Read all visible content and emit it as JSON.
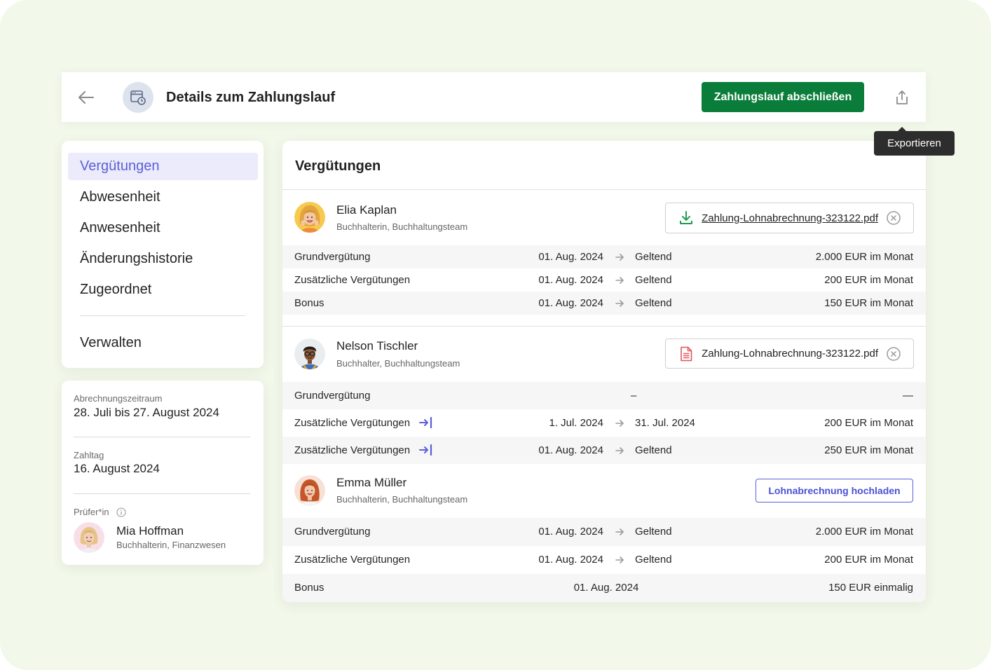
{
  "header": {
    "back_icon": "arrow-left-icon",
    "page_icon": "calendar-clock-icon",
    "title": "Details zum Zahlungslauf",
    "primary_action": "Zahlungslauf abschließen",
    "export_icon": "share-upload-icon",
    "export_tooltip": "Exportieren"
  },
  "sidebar": {
    "items": [
      {
        "label": "Vergütungen",
        "selected": true
      },
      {
        "label": "Abwesenheit",
        "selected": false
      },
      {
        "label": "Anwesenheit",
        "selected": false
      },
      {
        "label": "Änderungshistorie",
        "selected": false
      },
      {
        "label": "Zugeordnet",
        "selected": false
      }
    ],
    "manage": {
      "label": "Verwalten"
    }
  },
  "summary": {
    "period_label": "Abrechnungszeitraum",
    "period_value": "28. Juli bis 27. August 2024",
    "payday_label": "Zahltag",
    "payday_value": "16. August 2024",
    "reviewer_label": "Prüfer*in",
    "reviewer_info_icon": "info-icon",
    "reviewer_name": "Mia Hoffman",
    "reviewer_role": "Buchhalterin, Finanzwesen"
  },
  "main": {
    "title": "Vergütungen",
    "employees": [
      {
        "name": "Elia Kaplan",
        "role": "Buchhalterin, Buchhaltungsteam",
        "attachment": {
          "file_name": "Zahlung-Lohnabrechnung-323122.pdf",
          "icon": "download-icon",
          "remove_icon": "close-circle-icon"
        },
        "rows": [
          {
            "label": "Grundvergütung",
            "from": "01. Aug. 2024",
            "to": "Geltend",
            "amount": "2.000 EUR im Monat"
          },
          {
            "label": "Zusätzliche Vergütungen",
            "from": "01. Aug. 2024",
            "to": "Geltend",
            "amount": "200 EUR im Monat"
          },
          {
            "label": "Bonus",
            "from": "01. Aug. 2024",
            "to": "Geltend",
            "amount": "150 EUR im Monat"
          }
        ]
      },
      {
        "name": "Nelson Tischler",
        "role": "Buchhalter, Buchhaltungsteam",
        "attachment": {
          "file_name": "Zahlung-Lohnabrechnung-323122.pdf",
          "icon": "pdf-file-icon",
          "remove_icon": "close-circle-icon"
        },
        "rows": [
          {
            "label": "Grundvergütung",
            "to": "–",
            "amount": "—"
          },
          {
            "label": "Zusätzliche Vergütungen",
            "icon": "arrow-right-to-line-icon",
            "from": "1. Jul. 2024",
            "to": "31. Jul. 2024",
            "amount": "200 EUR im Monat"
          },
          {
            "label": "Zusätzliche Vergütungen",
            "icon": "arrow-right-to-line-icon",
            "from": "01. Aug. 2024",
            "to": "Geltend",
            "amount": "250 EUR im Monat"
          }
        ]
      },
      {
        "name": "Emma Müller",
        "role": "Buchhalterin, Buchhaltungsteam",
        "upload_button": "Lohnabrechnung hochladen",
        "rows": [
          {
            "label": "Grundvergütung",
            "from": "01. Aug. 2024",
            "to": "Geltend",
            "amount": "2.000 EUR im Monat"
          },
          {
            "label": "Zusätzliche Vergütungen",
            "from": "01. Aug. 2024",
            "to": "Geltend",
            "amount": "200 EUR im Monat"
          },
          {
            "label": "Bonus",
            "date": "01. Aug. 2024",
            "amount": "150 EUR einmalig"
          }
        ]
      }
    ]
  },
  "colors": {
    "page_background": "#f2f8ea",
    "primary": "#0b7d3a",
    "accent": "#5a5fd8",
    "selected_background": "#ebebfb",
    "download": "#1f9d4e",
    "pdf": "#e0565b",
    "tooltip": "#2d2d2d"
  }
}
